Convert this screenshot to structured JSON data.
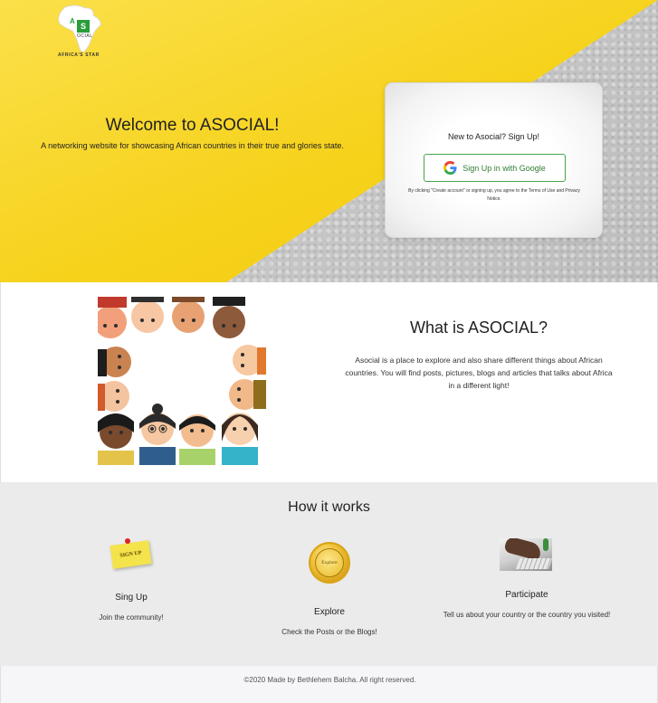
{
  "logo": {
    "letter_a": "A",
    "letter_s": "S",
    "subtext": "OCIAL",
    "tagline": "AFRICA'S STAR",
    "icon": "africa-map-logo"
  },
  "hero": {
    "title": "Welcome to ASOCIAL!",
    "subtitle": "A networking website for showcasing African countries in their true and glories state.",
    "card": {
      "title": "New to Asocial? Sign Up!",
      "google_button": "Sign Up in with Google",
      "google_icon": "google-g-icon",
      "terms": "By clicking \"Create account\" or signing up, you agree to the Terms of Use and Privacy Notice."
    }
  },
  "about": {
    "title": "What is ASOCIAL?",
    "description": "Asocial is a place to explore and also share different things about African countries. You will find posts, pictures, blogs and articles that talks about Africa in a different light!",
    "image": "diverse-faces-illustration"
  },
  "how_it_works": {
    "title": "How it works",
    "steps": [
      {
        "title": "Sing Up",
        "desc": "Join the community!",
        "icon": "sign-up-sticky-note",
        "icon_text": "SIGN UP"
      },
      {
        "title": "Explore",
        "desc": "Check the Posts or the Blogs!",
        "icon": "explore-gold-badge",
        "icon_text": "Explore"
      },
      {
        "title": "Participate",
        "desc": "Tell us about your country or the country you visited!",
        "icon": "typing-hands-photo"
      }
    ]
  },
  "footer": {
    "text": "©2020 Made by Bethlehem Balcha. All right reserved."
  },
  "colors": {
    "hero_yellow": "#f6d21b",
    "google_green": "#48a34d",
    "section_gray": "#ebebeb",
    "footer_bg": "#f6f6f8"
  }
}
